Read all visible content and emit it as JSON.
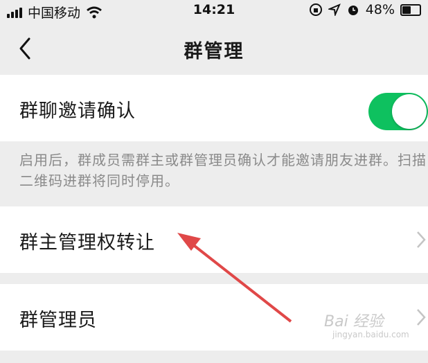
{
  "status_bar": {
    "carrier": "中国移动",
    "time": "14:21",
    "battery_percent": "48%",
    "battery_level": 0.48,
    "icons": [
      "signal-icon",
      "wifi-icon",
      "orientation-lock-icon",
      "location-icon",
      "alarm-icon",
      "battery-icon"
    ]
  },
  "nav": {
    "title": "群管理",
    "back_icon": "chevron-left-icon"
  },
  "settings": {
    "invite_confirm": {
      "label": "群聊邀请确认",
      "enabled": true,
      "description": "启用后，群成员需群主或群管理员确认才能邀请朋友进群。扫描二维码进群将同时停用。"
    },
    "transfer_owner": {
      "label": "群主管理权转让"
    },
    "admins": {
      "label": "群管理员"
    }
  },
  "annotation": {
    "type": "red-arrow",
    "color": "#e04848"
  },
  "watermark": {
    "text": "Bai 经验",
    "sub": "jingyan.baidu.com"
  },
  "colors": {
    "accent": "#0ec15f",
    "background": "#ededed",
    "arrow": "#e04848"
  }
}
